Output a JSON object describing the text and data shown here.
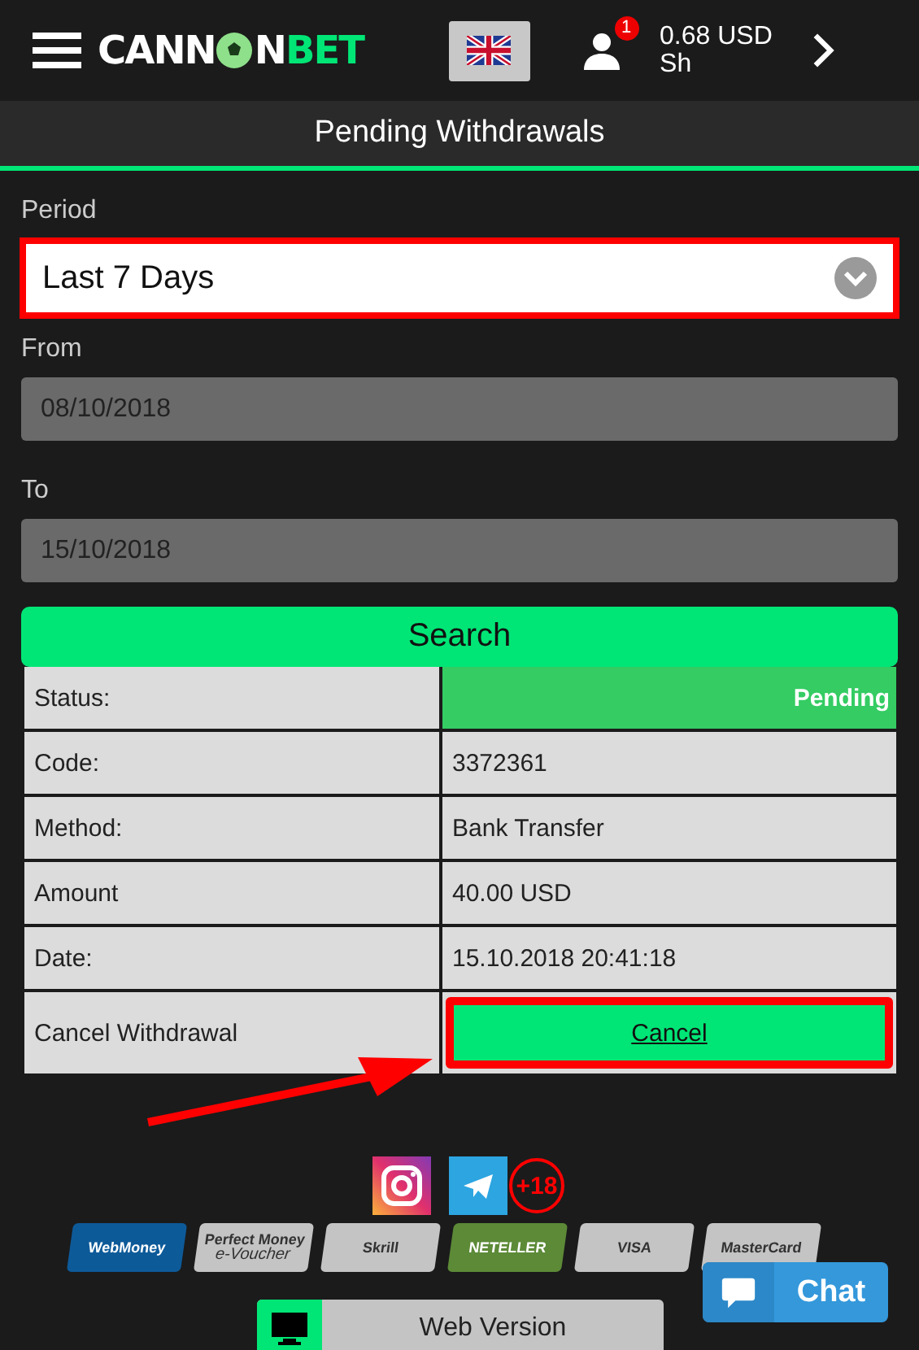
{
  "header": {
    "logo": {
      "part_1": "CANN",
      "part_2": "N",
      "part_3": "BET"
    },
    "notification_count": "1",
    "balance": "0.68 USD",
    "username": "Sh"
  },
  "page_title": "Pending Withdrawals",
  "form": {
    "period": {
      "label": "Period",
      "value": "Last 7 Days",
      "highlighted": true
    },
    "from": {
      "label": "From",
      "value": "08/10/2018",
      "disabled": true
    },
    "to": {
      "label": "To",
      "value": "15/10/2018",
      "disabled": true
    },
    "search_button": "Search"
  },
  "details": [
    {
      "label": "Status:",
      "value": "Pending",
      "kind": "status"
    },
    {
      "label": "Code:",
      "value": "3372361",
      "kind": "text"
    },
    {
      "label": "Method:",
      "value": "Bank Transfer",
      "kind": "text"
    },
    {
      "label": "Amount",
      "value": "40.00 USD",
      "kind": "text"
    },
    {
      "label": "Date:",
      "value": "15.10.2018 20:41:18",
      "kind": "text"
    },
    {
      "label": "Cancel Withdrawal",
      "value": "Cancel",
      "kind": "button",
      "highlighted": true
    }
  ],
  "annotation_arrow": true,
  "age_badge": "+18",
  "payments": [
    {
      "label": "WebMoney",
      "color": "#0d5a99"
    },
    {
      "label": "Perfect Money",
      "sub": "e-Voucher",
      "color": "#c4c4c4"
    },
    {
      "label": "Skrill",
      "color": "#c4c4c4"
    },
    {
      "label": "NETELLER",
      "color": "#5c8a37"
    },
    {
      "label": "VISA",
      "color": "#c4c4c4"
    },
    {
      "label": "MasterCard",
      "color": "#c4c4c4"
    }
  ],
  "web_version": "Web Version",
  "chat": "Chat"
}
